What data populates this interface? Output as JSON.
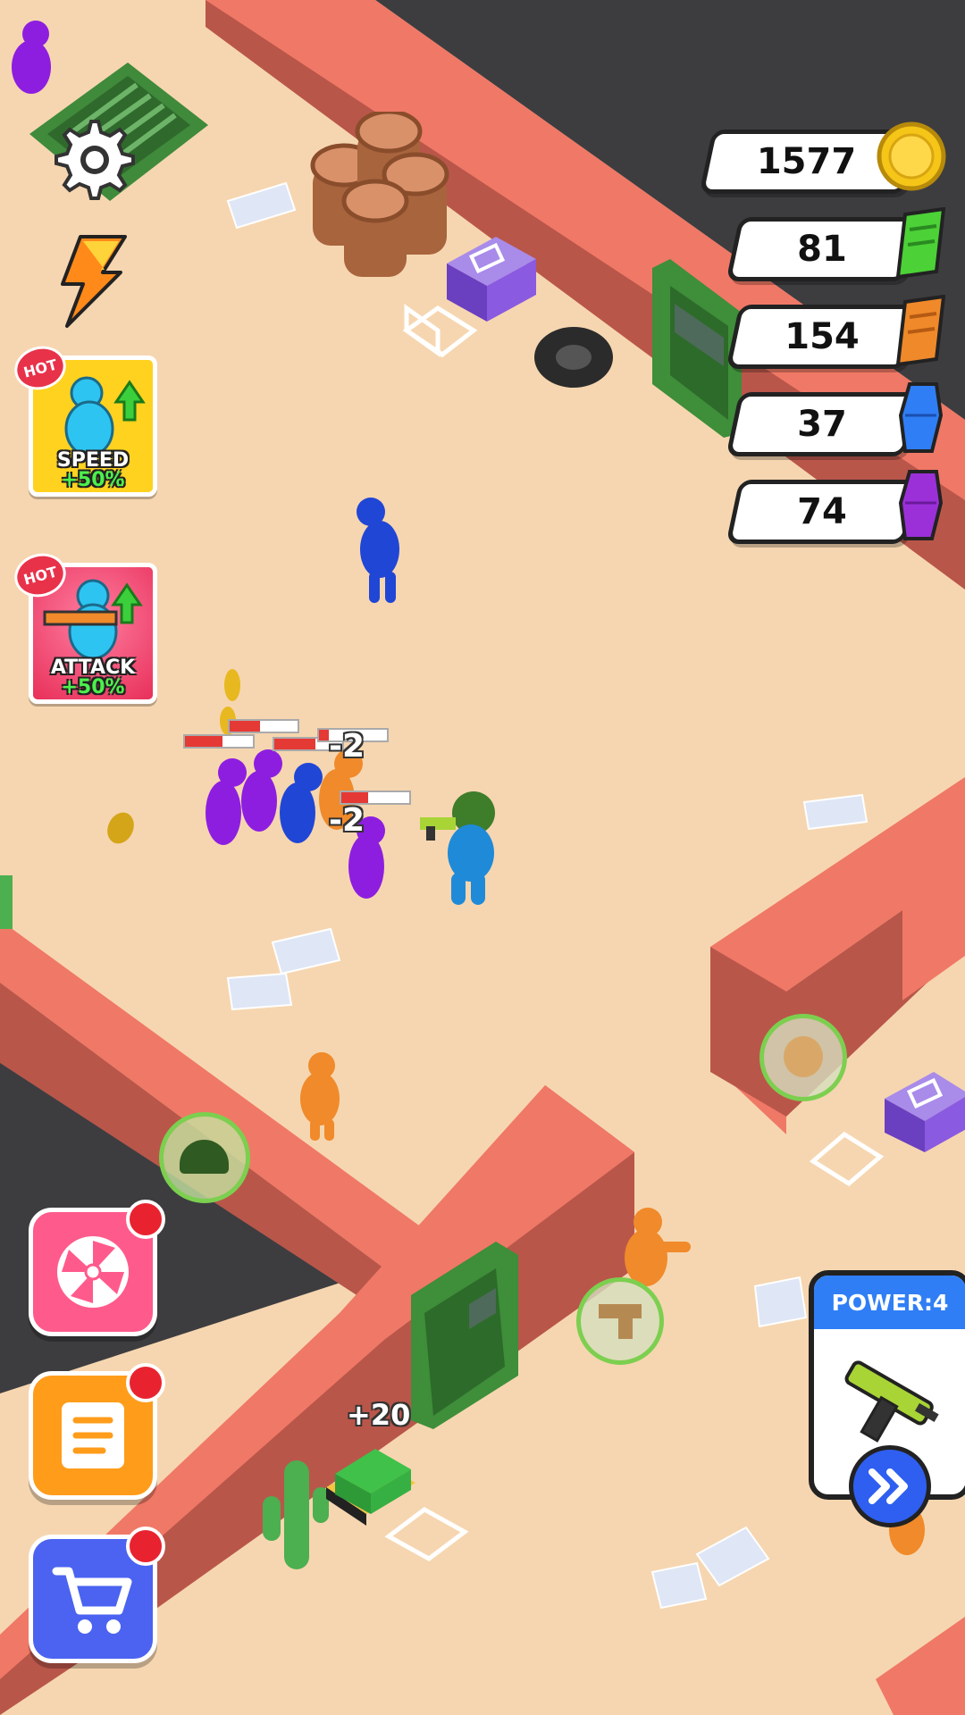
{
  "hud": {
    "resources": [
      {
        "name": "coins",
        "value": "1577",
        "color": "#f5c518",
        "icon": "gold-coin-icon"
      },
      {
        "name": "green",
        "value": "81",
        "color": "#4cd137",
        "icon": "green-battery-icon"
      },
      {
        "name": "orange",
        "value": "154",
        "color": "#f0892a",
        "icon": "orange-battery-icon"
      },
      {
        "name": "blue",
        "value": "37",
        "color": "#2f7ef5",
        "icon": "blue-gem-icon"
      },
      {
        "name": "purple",
        "value": "74",
        "color": "#9b30d9",
        "icon": "purple-gem-icon"
      }
    ]
  },
  "boosts": [
    {
      "hot": "HOT",
      "label": "SPEED",
      "percent": "+50%",
      "color": "#ffd21f"
    },
    {
      "hot": "HOT",
      "label": "ATTACK",
      "percent": "+50%",
      "color": "#ff4d79"
    }
  ],
  "side_buttons": [
    {
      "name": "wheel",
      "icon": "fan-wheel-icon",
      "color": "#ff5a8c"
    },
    {
      "name": "quests",
      "icon": "scroll-icon",
      "color": "#ff9c1a"
    },
    {
      "name": "shop",
      "icon": "shopping-cart-icon",
      "color": "#4b63f0"
    }
  ],
  "power": {
    "label": "POWER:4",
    "weapon_icon": "uzi-gun-icon"
  },
  "floating": {
    "damage": [
      "-2",
      "-2"
    ],
    "pickup": "+20"
  },
  "colors": {
    "ground": "#f6d6b0",
    "wall_top": "#f07866",
    "wall_side": "#b9564a",
    "void": "#3d3d40"
  }
}
